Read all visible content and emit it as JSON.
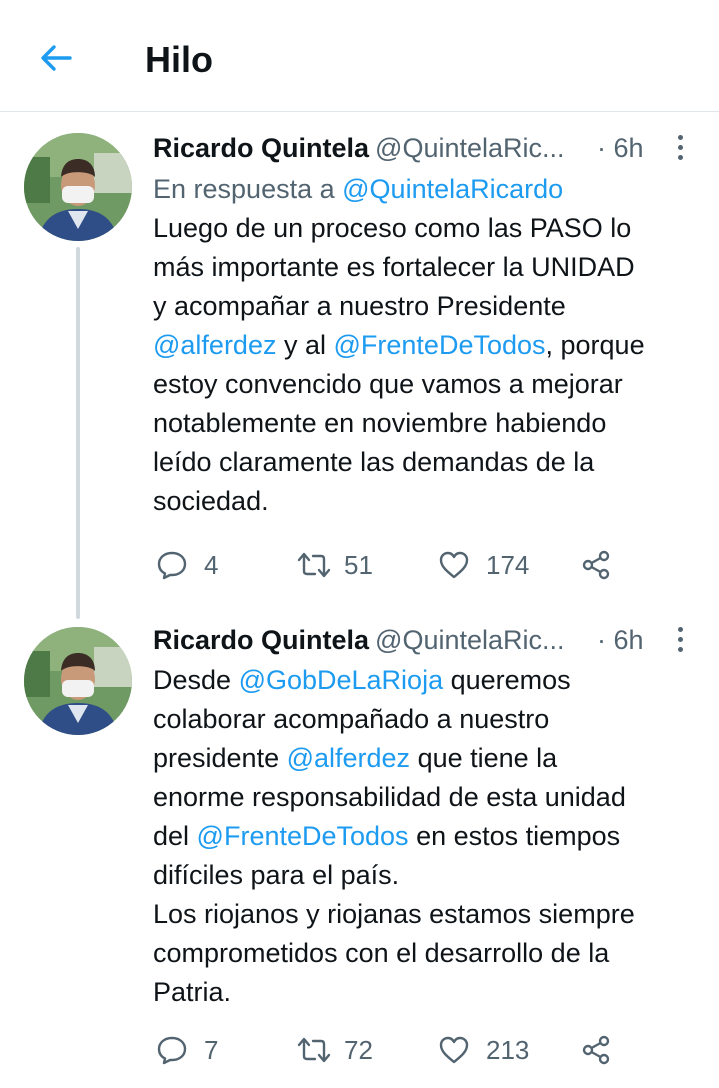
{
  "header": {
    "title": "Hilo"
  },
  "tweets": [
    {
      "name": "Ricardo Quintela",
      "handle": "@QuintelaRic...",
      "time": "· 6h",
      "reply_prefix": "En respuesta a",
      "reply_to": "@QuintelaRicardo",
      "lines": [
        [
          "Luego de un proceso como las PASO lo"
        ],
        [
          "más importante es fortalecer la UNIDAD"
        ],
        [
          "y acompañar a nuestro Presidente"
        ],
        [
          "@alferdez",
          " y al ",
          "@FrenteDeTodos",
          ", porque"
        ],
        [
          "estoy convencido que vamos a mejorar"
        ],
        [
          "notablemente en noviembre habiendo"
        ],
        [
          "leído claramente las demandas de la"
        ],
        [
          "sociedad."
        ]
      ],
      "replies": "4",
      "retweets": "51",
      "likes": "174"
    },
    {
      "name": "Ricardo Quintela",
      "handle": "@QuintelaRic...",
      "time": "· 6h",
      "lines": [
        [
          "Desde ",
          "@GobDeLaRioja",
          " queremos"
        ],
        [
          "colaborar acompañado a nuestro"
        ],
        [
          "presidente ",
          "@alferdez",
          " que tiene la"
        ],
        [
          "enorme responsabilidad de esta unidad"
        ],
        [
          "del ",
          "@FrenteDeTodos",
          " en estos tiempos"
        ],
        [
          "difíciles para el país."
        ],
        [
          "Los riojanos y riojanas estamos siempre"
        ],
        [
          "comprometidos con el desarrollo de la"
        ],
        [
          "Patria."
        ]
      ],
      "replies": "7",
      "retweets": "72",
      "likes": "213"
    }
  ],
  "colors": {
    "accent": "#1d9bf0",
    "text": "#0f1419",
    "muted": "#536471",
    "thread_line": "#cfd9de"
  },
  "icons": [
    "back-arrow-icon",
    "more-icon",
    "reply-icon",
    "retweet-icon",
    "like-icon",
    "share-icon"
  ]
}
